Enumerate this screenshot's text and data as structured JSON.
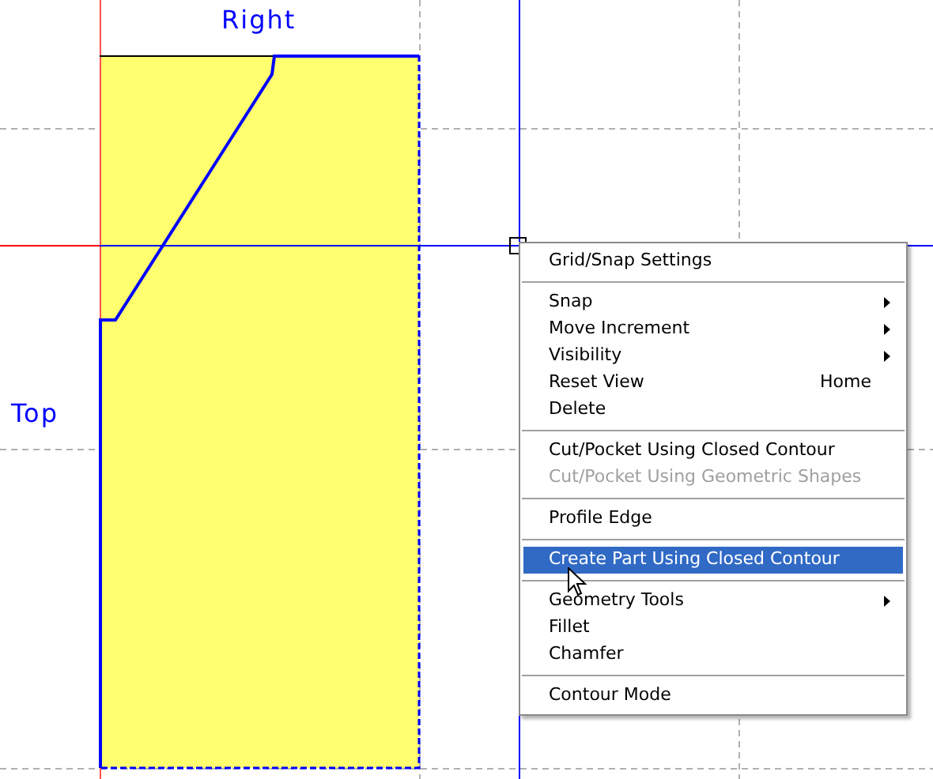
{
  "view_labels": [
    {
      "kind": "top_label",
      "text": "Right"
    },
    {
      "kind": "side_label",
      "text": "Top"
    }
  ],
  "context_menu": {
    "items": [
      {
        "kind": "item",
        "label": "Grid/Snap Settings",
        "submenu": false,
        "disabled": false,
        "selected": false
      },
      {
        "kind": "separator"
      },
      {
        "kind": "item",
        "label": "Snap",
        "submenu": true,
        "disabled": false,
        "selected": false
      },
      {
        "kind": "item",
        "label": "Move Increment",
        "submenu": true,
        "disabled": false,
        "selected": false
      },
      {
        "kind": "item",
        "label": "Visibility",
        "submenu": true,
        "disabled": false,
        "selected": false
      },
      {
        "kind": "item",
        "label": "Reset View",
        "shortcut": "Home",
        "submenu": false,
        "disabled": false,
        "selected": false
      },
      {
        "kind": "item",
        "label": "Delete",
        "submenu": false,
        "disabled": false,
        "selected": false
      },
      {
        "kind": "separator"
      },
      {
        "kind": "item",
        "label": "Cut/Pocket Using Closed Contour",
        "submenu": false,
        "disabled": false,
        "selected": false
      },
      {
        "kind": "item",
        "label": "Cut/Pocket Using Geometric Shapes",
        "submenu": false,
        "disabled": true,
        "selected": false
      },
      {
        "kind": "separator"
      },
      {
        "kind": "item",
        "label": "Profile Edge",
        "submenu": false,
        "disabled": false,
        "selected": false
      },
      {
        "kind": "separator"
      },
      {
        "kind": "item",
        "label": "Create Part Using Closed Contour",
        "submenu": false,
        "disabled": false,
        "selected": true
      },
      {
        "kind": "separator"
      },
      {
        "kind": "item",
        "label": "Geometry Tools",
        "submenu": true,
        "disabled": false,
        "selected": false
      },
      {
        "kind": "item",
        "label": "Fillet",
        "submenu": false,
        "disabled": false,
        "selected": false
      },
      {
        "kind": "item",
        "label": "Chamfer",
        "submenu": false,
        "disabled": false,
        "selected": false
      },
      {
        "kind": "separator"
      },
      {
        "kind": "item",
        "label": "Contour Mode",
        "submenu": false,
        "disabled": false,
        "selected": false
      }
    ]
  }
}
